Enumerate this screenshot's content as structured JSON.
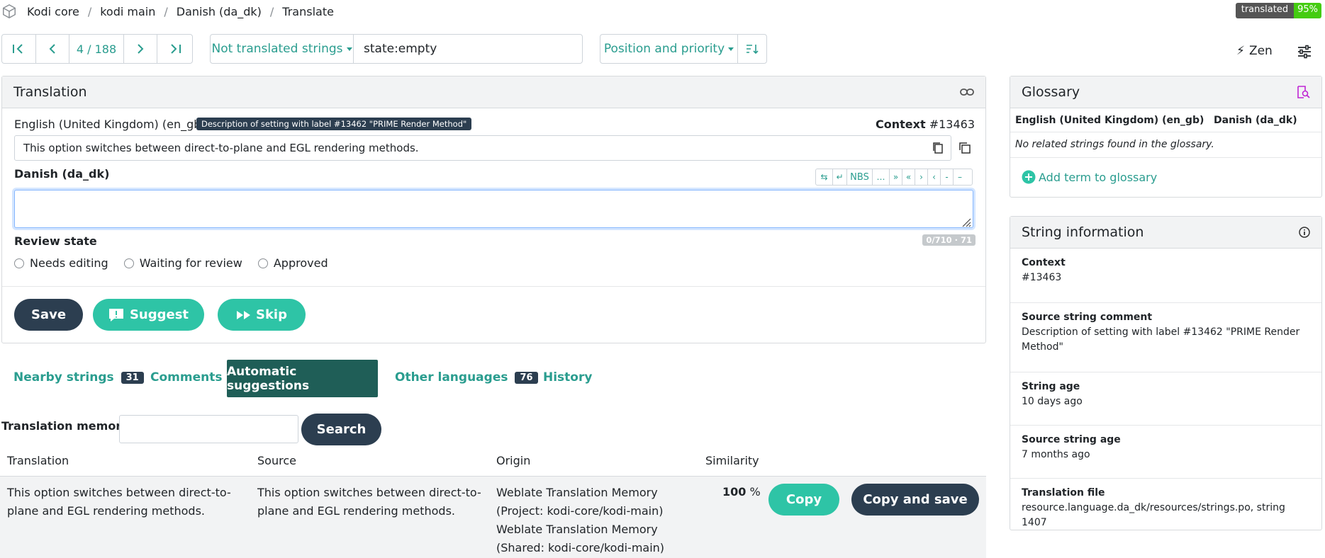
{
  "breadcrumb": [
    "Kodi core",
    "kodi main",
    "Danish (da_dk)",
    "Translate"
  ],
  "badge": {
    "label": "translated",
    "value": "95%"
  },
  "nav": {
    "position": "4 / 188"
  },
  "filter": {
    "label": "Not translated strings",
    "query": "state:empty"
  },
  "sort": {
    "label": "Position and priority"
  },
  "zen": "Zen",
  "translation": {
    "title": "Translation",
    "source_lang": "English (United Kingdom) (en_gb)",
    "tooltip": "Description of setting with label #13462 \"PRIME Render Method\"",
    "context_label": "Context",
    "context_value": "#13463",
    "source_text": "This option switches between direct-to-plane and EGL rendering methods.",
    "target_lang": "Danish (da_dk)",
    "keys": [
      "⇆",
      "↵",
      "NBS",
      "…",
      "»",
      "«",
      "›",
      "‹",
      "-",
      "–"
    ],
    "target_value": "",
    "counter": "0/710 · 71",
    "review_label": "Review state",
    "review_options": [
      "Needs editing",
      "Waiting for review",
      "Approved"
    ],
    "save": "Save",
    "suggest": "Suggest",
    "skip": "Skip"
  },
  "tabs": [
    {
      "label": "Nearby strings",
      "count": "31"
    },
    {
      "label": "Comments"
    },
    {
      "label": "Automatic suggestions"
    },
    {
      "label": "Other languages",
      "count": "76"
    },
    {
      "label": "History"
    }
  ],
  "memory": {
    "label": "Translation memory",
    "search": "Search"
  },
  "table": {
    "headers": [
      "Translation",
      "Source",
      "Origin",
      "Similarity"
    ],
    "row": {
      "translation": "This option switches between direct-to-plane and EGL rendering methods.",
      "source": "This option switches between direct-to-plane and EGL rendering methods.",
      "origin1": "Weblate Translation Memory (Project: kodi-core/kodi-main)",
      "origin2": "Weblate Translation Memory (Shared: kodi-core/kodi-main)",
      "similarity": "100",
      "similarity_unit": "%",
      "copy": "Copy",
      "copy_save": "Copy and save"
    }
  },
  "glossary": {
    "title": "Glossary",
    "col1": "English (United Kingdom) (en_gb)",
    "col2": "Danish (da_dk)",
    "empty": "No related strings found in the glossary.",
    "add": "Add term to glossary"
  },
  "info": {
    "title": "String information",
    "context_label": "Context",
    "context_value": "#13463",
    "comment_label": "Source string comment",
    "comment_value": "Description of setting with label #13462 \"PRIME Render Method\"",
    "age_label": "String age",
    "age_value": "10 days ago",
    "src_age_label": "Source string age",
    "src_age_value": "7 months ago",
    "file_label": "Translation file",
    "file_value": "resource.language.da_dk/resources/strings.po, string 1407"
  },
  "colors": {
    "teal": "#2a9d8f",
    "dark": "#2c3e50",
    "accent_purple": "#c026d3"
  }
}
